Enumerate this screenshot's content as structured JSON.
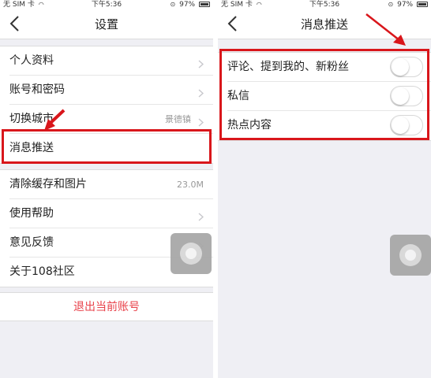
{
  "left": {
    "status": {
      "carrier": "无 SIM 卡",
      "time": "下午5:36",
      "battery": "97%"
    },
    "nav": {
      "title": "设置"
    },
    "group1": [
      {
        "label": "个人资料",
        "value": ""
      },
      {
        "label": "账号和密码",
        "value": ""
      },
      {
        "label": "切换城市",
        "value": "景德镇"
      },
      {
        "label": "消息推送",
        "value": ""
      }
    ],
    "group2": [
      {
        "label": "清除缓存和图片",
        "value": "23.0M"
      },
      {
        "label": "使用帮助",
        "value": ""
      },
      {
        "label": "意见反馈",
        "value": ""
      },
      {
        "label": "关于108社区",
        "value": ""
      }
    ],
    "logout": "退出当前账号"
  },
  "right": {
    "status": {
      "carrier": "无 SIM 卡",
      "time": "下午5:36",
      "battery": "97%"
    },
    "nav": {
      "title": "消息推送"
    },
    "toggles": [
      {
        "label": "评论、提到我的、新粉丝",
        "on": false
      },
      {
        "label": "私信",
        "on": false
      },
      {
        "label": "热点内容",
        "on": false
      }
    ]
  },
  "colors": {
    "highlight": "#d9161b",
    "logout": "#e8414a",
    "background": "#efeff4"
  },
  "icons": [
    "back-chevron-icon",
    "chevron-right-icon",
    "wifi-icon",
    "battery-icon",
    "orientation-lock-icon",
    "assistive-touch-icon",
    "pointer-arrow-icon"
  ]
}
